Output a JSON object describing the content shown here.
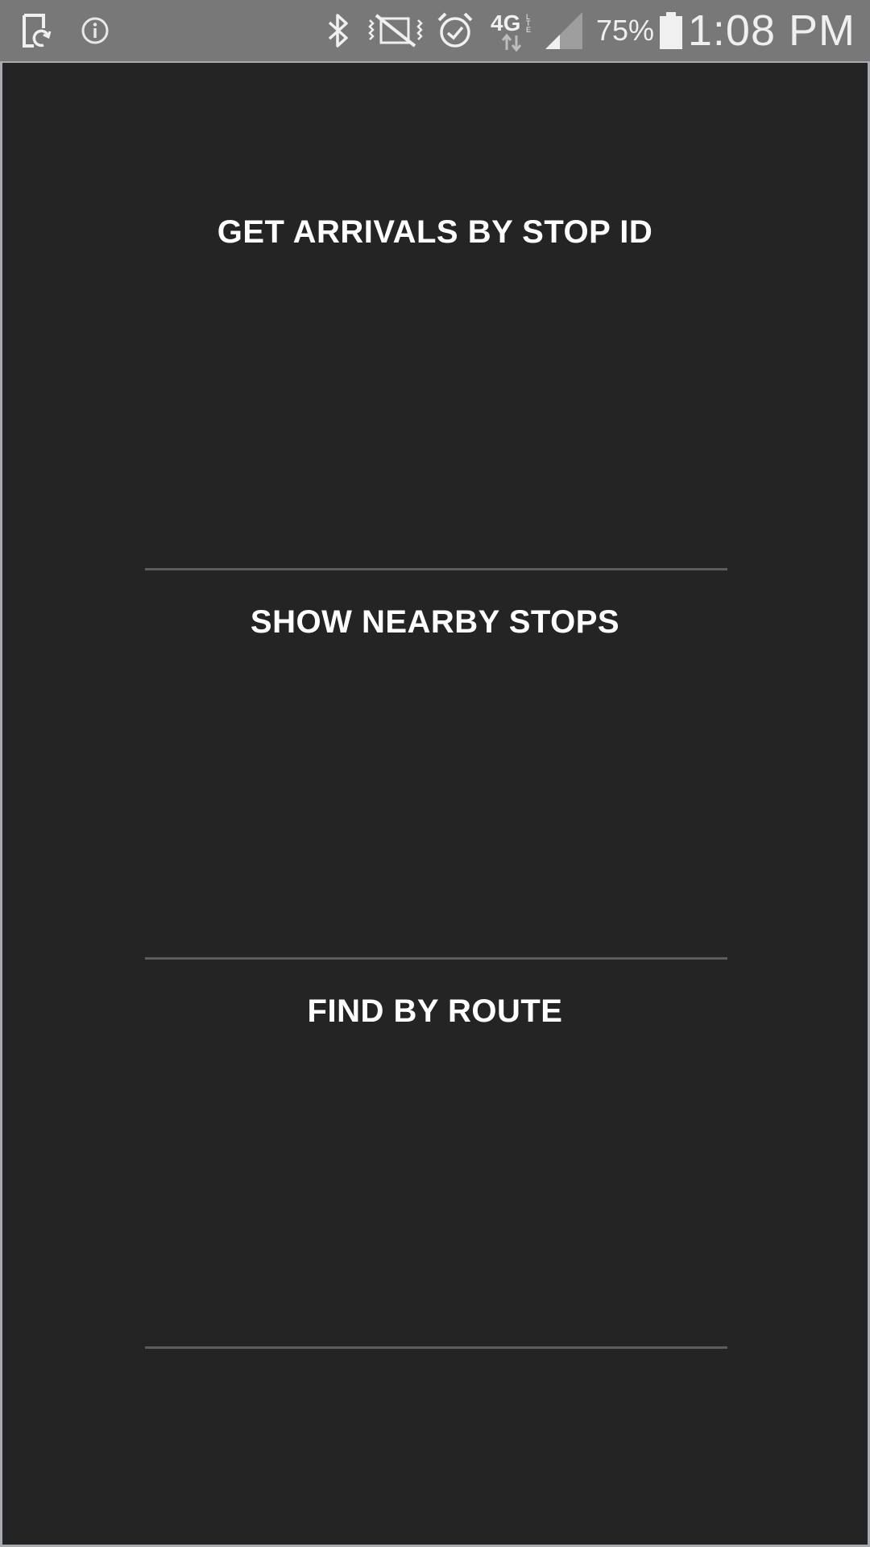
{
  "status_bar": {
    "icons": [
      "screen-rotate-icon",
      "info-icon",
      "bluetooth-icon",
      "vibrate-icon",
      "alarm-icon",
      "4g-lte-icon",
      "signal-icon",
      "battery-icon"
    ],
    "battery_percent": "75%",
    "time": "1:08 PM"
  },
  "menu": {
    "items": [
      {
        "label": "GET ARRIVALS BY STOP ID"
      },
      {
        "label": "SHOW NEARBY STOPS"
      },
      {
        "label": "FIND BY ROUTE"
      }
    ]
  },
  "colors": {
    "background": "#242424",
    "status_bar": "#787878",
    "divider": "#5c5c5c",
    "label": "#ffffff"
  }
}
